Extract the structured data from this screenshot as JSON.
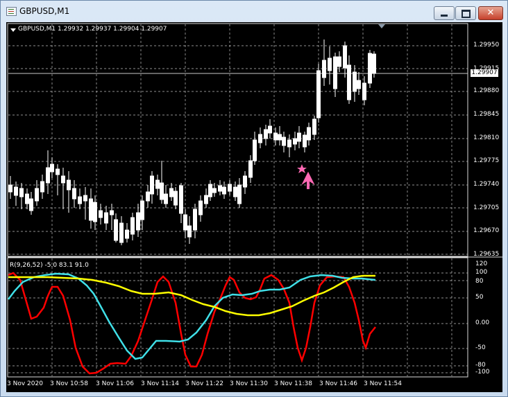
{
  "window": {
    "title": "GBPUSD,M1"
  },
  "chart": {
    "symbol_line": "GBPUSD,M1  1.29932 1.29937 1.29904 1.29907",
    "current_price": "1.29907",
    "indicator_label": "R(9,26,52) -5.0 83.1 91.0",
    "price_axis": [
      "1.29950",
      "1.29915",
      "1.29880",
      "1.29845",
      "1.29810",
      "1.29775",
      "1.29740",
      "1.29705",
      "1.29670",
      "1.29635"
    ],
    "indicator_axis": [
      "120",
      "100",
      "80",
      "50",
      "0.00",
      "-50",
      "-80",
      "-100"
    ],
    "time_axis": [
      "3 Nov 2020",
      "3 Nov 10:58",
      "3 Nov 11:06",
      "3 Nov 11:14",
      "3 Nov 11:22",
      "3 Nov 11:30",
      "3 Nov 11:38",
      "3 Nov 11:46",
      "3 Nov 11:54"
    ]
  },
  "colors": {
    "bull": "#00ff00",
    "bear": "#ffffff",
    "grid": "#c0c0c0",
    "red_line": "#ff0000",
    "cyan_line": "#40e0e8",
    "yellow_line": "#ffff00",
    "signal": "#ff69b4"
  }
}
